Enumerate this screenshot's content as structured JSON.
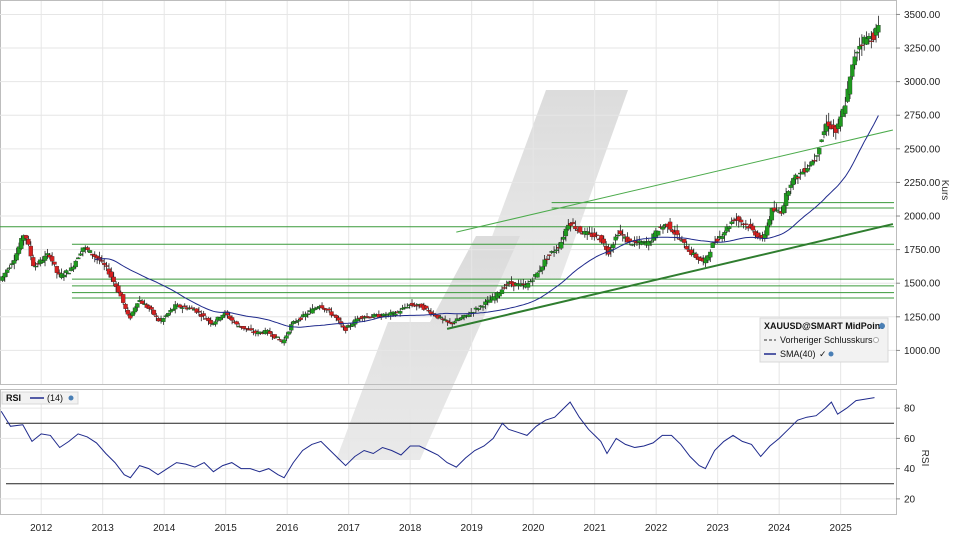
{
  "chart_data": [
    {
      "type": "candlestick",
      "symbol": "XAUUSD@SMART MidPoint",
      "ylabel": "Kurs",
      "ylim": [
        750,
        3600
      ],
      "yticks": [
        "1000.00",
        "1250.00",
        "1500.00",
        "1750.00",
        "2000.00",
        "2250.00",
        "2500.00",
        "2750.00",
        "3000.00",
        "3250.00",
        "3500.00"
      ],
      "x_ticks": [
        "2012",
        "2013",
        "2014",
        "2015",
        "2016",
        "2017",
        "2018",
        "2019",
        "2020",
        "2021",
        "2022",
        "2023",
        "2024",
        "2025"
      ],
      "xlim": [
        2011.33,
        2025.9
      ],
      "legend": [
        {
          "label": "XAUUSD@SMART MidPoint"
        },
        {
          "label": "Vorheriger Schlusskurs"
        },
        {
          "label": "SMA(40)"
        }
      ],
      "price_anchors": [
        [
          2011.35,
          1520
        ],
        [
          2011.6,
          1700
        ],
        [
          2011.75,
          1880
        ],
        [
          2011.9,
          1620
        ],
        [
          2012.15,
          1720
        ],
        [
          2012.3,
          1550
        ],
        [
          2012.5,
          1600
        ],
        [
          2012.7,
          1770
        ],
        [
          2012.95,
          1680
        ],
        [
          2013.1,
          1600
        ],
        [
          2013.3,
          1420
        ],
        [
          2013.45,
          1230
        ],
        [
          2013.6,
          1380
        ],
        [
          2013.8,
          1300
        ],
        [
          2013.95,
          1210
        ],
        [
          2014.2,
          1330
        ],
        [
          2014.5,
          1310
        ],
        [
          2014.8,
          1200
        ],
        [
          2015.0,
          1280
        ],
        [
          2015.2,
          1190
        ],
        [
          2015.5,
          1130
        ],
        [
          2015.7,
          1140
        ],
        [
          2015.95,
          1060
        ],
        [
          2016.1,
          1200
        ],
        [
          2016.3,
          1260
        ],
        [
          2016.55,
          1340
        ],
        [
          2016.8,
          1250
        ],
        [
          2016.95,
          1150
        ],
        [
          2017.2,
          1250
        ],
        [
          2017.6,
          1260
        ],
        [
          2017.8,
          1280
        ],
        [
          2018.0,
          1340
        ],
        [
          2018.2,
          1330
        ],
        [
          2018.5,
          1240
        ],
        [
          2018.65,
          1200
        ],
        [
          2018.9,
          1250
        ],
        [
          2019.1,
          1310
        ],
        [
          2019.4,
          1400
        ],
        [
          2019.6,
          1500
        ],
        [
          2019.9,
          1480
        ],
        [
          2020.1,
          1580
        ],
        [
          2020.25,
          1700
        ],
        [
          2020.45,
          1780
        ],
        [
          2020.6,
          1960
        ],
        [
          2020.8,
          1880
        ],
        [
          2021.1,
          1840
        ],
        [
          2021.25,
          1730
        ],
        [
          2021.4,
          1880
        ],
        [
          2021.6,
          1800
        ],
        [
          2021.9,
          1800
        ],
        [
          2022.05,
          1900
        ],
        [
          2022.2,
          1940
        ],
        [
          2022.4,
          1830
        ],
        [
          2022.6,
          1720
        ],
        [
          2022.8,
          1650
        ],
        [
          2022.95,
          1800
        ],
        [
          2023.1,
          1870
        ],
        [
          2023.3,
          1990
        ],
        [
          2023.5,
          1930
        ],
        [
          2023.75,
          1820
        ],
        [
          2023.9,
          2040
        ],
        [
          2024.05,
          2030
        ],
        [
          2024.2,
          2250
        ],
        [
          2024.4,
          2330
        ],
        [
          2024.6,
          2430
        ],
        [
          2024.8,
          2700
        ],
        [
          2024.95,
          2620
        ],
        [
          2025.1,
          2850
        ],
        [
          2025.25,
          3200
        ],
        [
          2025.35,
          3300
        ],
        [
          2025.55,
          3340
        ],
        [
          2025.62,
          3400
        ]
      ],
      "sma_period": 40,
      "horizontal_levels": [
        1920,
        1790,
        1530,
        1480,
        1430,
        1390,
        2100,
        2060
      ],
      "trend_lines": [
        {
          "from": [
            2018.6,
            1160
          ],
          "to": [
            2025.85,
            1940
          ]
        },
        {
          "from": [
            2018.75,
            1880
          ],
          "to": [
            2025.85,
            2640
          ]
        }
      ]
    },
    {
      "type": "line",
      "name": "RSI",
      "legend": [
        {
          "label": "RSI"
        },
        {
          "label": "(14)"
        }
      ],
      "ylabel": "RSI",
      "ylim": [
        10,
        92
      ],
      "yticks": [
        "20",
        "40",
        "60",
        "80"
      ],
      "levels": [
        70,
        30
      ],
      "values": [
        [
          2011.35,
          78
        ],
        [
          2011.5,
          68
        ],
        [
          2011.7,
          69
        ],
        [
          2011.85,
          58
        ],
        [
          2012.0,
          63
        ],
        [
          2012.15,
          62
        ],
        [
          2012.3,
          54
        ],
        [
          2012.45,
          58
        ],
        [
          2012.6,
          63
        ],
        [
          2012.75,
          61
        ],
        [
          2012.9,
          57
        ],
        [
          2013.05,
          50
        ],
        [
          2013.2,
          44
        ],
        [
          2013.35,
          36
        ],
        [
          2013.45,
          34
        ],
        [
          2013.6,
          42
        ],
        [
          2013.75,
          40
        ],
        [
          2013.9,
          36
        ],
        [
          2014.05,
          40
        ],
        [
          2014.2,
          44
        ],
        [
          2014.35,
          43
        ],
        [
          2014.5,
          41
        ],
        [
          2014.65,
          44
        ],
        [
          2014.8,
          38
        ],
        [
          2014.95,
          42
        ],
        [
          2015.1,
          44
        ],
        [
          2015.25,
          40
        ],
        [
          2015.4,
          40
        ],
        [
          2015.55,
          38
        ],
        [
          2015.7,
          40
        ],
        [
          2015.85,
          36
        ],
        [
          2015.95,
          34
        ],
        [
          2016.1,
          44
        ],
        [
          2016.25,
          52
        ],
        [
          2016.4,
          56
        ],
        [
          2016.55,
          58
        ],
        [
          2016.7,
          52
        ],
        [
          2016.85,
          46
        ],
        [
          2016.95,
          42
        ],
        [
          2017.1,
          48
        ],
        [
          2017.25,
          52
        ],
        [
          2017.4,
          50
        ],
        [
          2017.55,
          54
        ],
        [
          2017.7,
          52
        ],
        [
          2017.85,
          49
        ],
        [
          2018.0,
          55
        ],
        [
          2018.15,
          55
        ],
        [
          2018.3,
          52
        ],
        [
          2018.45,
          49
        ],
        [
          2018.6,
          44
        ],
        [
          2018.75,
          41
        ],
        [
          2018.9,
          47
        ],
        [
          2019.05,
          52
        ],
        [
          2019.2,
          55
        ],
        [
          2019.35,
          60
        ],
        [
          2019.5,
          70
        ],
        [
          2019.6,
          66
        ],
        [
          2019.75,
          64
        ],
        [
          2019.9,
          62
        ],
        [
          2020.05,
          68
        ],
        [
          2020.2,
          72
        ],
        [
          2020.35,
          74
        ],
        [
          2020.5,
          80
        ],
        [
          2020.6,
          84
        ],
        [
          2020.75,
          74
        ],
        [
          2020.9,
          66
        ],
        [
          2021.0,
          62
        ],
        [
          2021.1,
          58
        ],
        [
          2021.2,
          50
        ],
        [
          2021.35,
          60
        ],
        [
          2021.5,
          56
        ],
        [
          2021.65,
          54
        ],
        [
          2021.8,
          55
        ],
        [
          2021.95,
          57
        ],
        [
          2022.1,
          62
        ],
        [
          2022.25,
          62
        ],
        [
          2022.4,
          56
        ],
        [
          2022.55,
          48
        ],
        [
          2022.7,
          42
        ],
        [
          2022.8,
          40
        ],
        [
          2022.95,
          52
        ],
        [
          2023.1,
          58
        ],
        [
          2023.25,
          62
        ],
        [
          2023.4,
          58
        ],
        [
          2023.55,
          56
        ],
        [
          2023.7,
          48
        ],
        [
          2023.85,
          55
        ],
        [
          2024.0,
          60
        ],
        [
          2024.15,
          66
        ],
        [
          2024.3,
          72
        ],
        [
          2024.45,
          74
        ],
        [
          2024.6,
          75
        ],
        [
          2024.75,
          80
        ],
        [
          2024.85,
          84
        ],
        [
          2024.95,
          76
        ],
        [
          2025.1,
          80
        ],
        [
          2025.25,
          85
        ],
        [
          2025.4,
          86
        ],
        [
          2025.55,
          87
        ]
      ]
    }
  ]
}
